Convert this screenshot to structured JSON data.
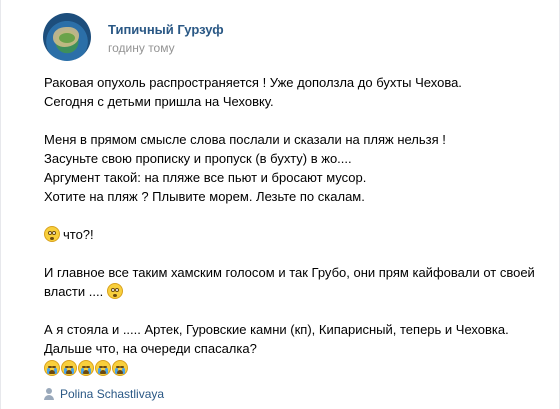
{
  "post": {
    "group_name": "Типичный Гурзуф",
    "time": "годину тому",
    "paragraphs": {
      "p1": "Раковая опухоль распространяется ! Уже доползла до бухты Чехова.",
      "p2": "Сегодня с детьми пришла на Чеховку.",
      "p3": "Меня в прямом смысле слова послали и сказали на пляж нельзя !",
      "p4": "Засуньте свою прописку и пропуск (в бухту) в жо....",
      "p5": "Аргумент такой: на пляже все пьют и бросают мусор.",
      "p6": "Хотите на пляж ? Плывите морем. Лезьте по скалам.",
      "p7": "что?!",
      "p8": "И главное все таким хамским голосом и так Грубо, они прям кайфовали от своей",
      "p9": "власти ....",
      "p10": "А я стояла и ..... Артек, Гуровские камни (кп), Кипарисный, теперь и Чеховка.",
      "p11": "Дальше что, на очереди спасалка?"
    },
    "emoji_icons": [
      "flushed-face",
      "flushed-face",
      "loudly-crying-face"
    ],
    "crying_emoji_count": 5,
    "author": "Polina Schastlivaya"
  }
}
